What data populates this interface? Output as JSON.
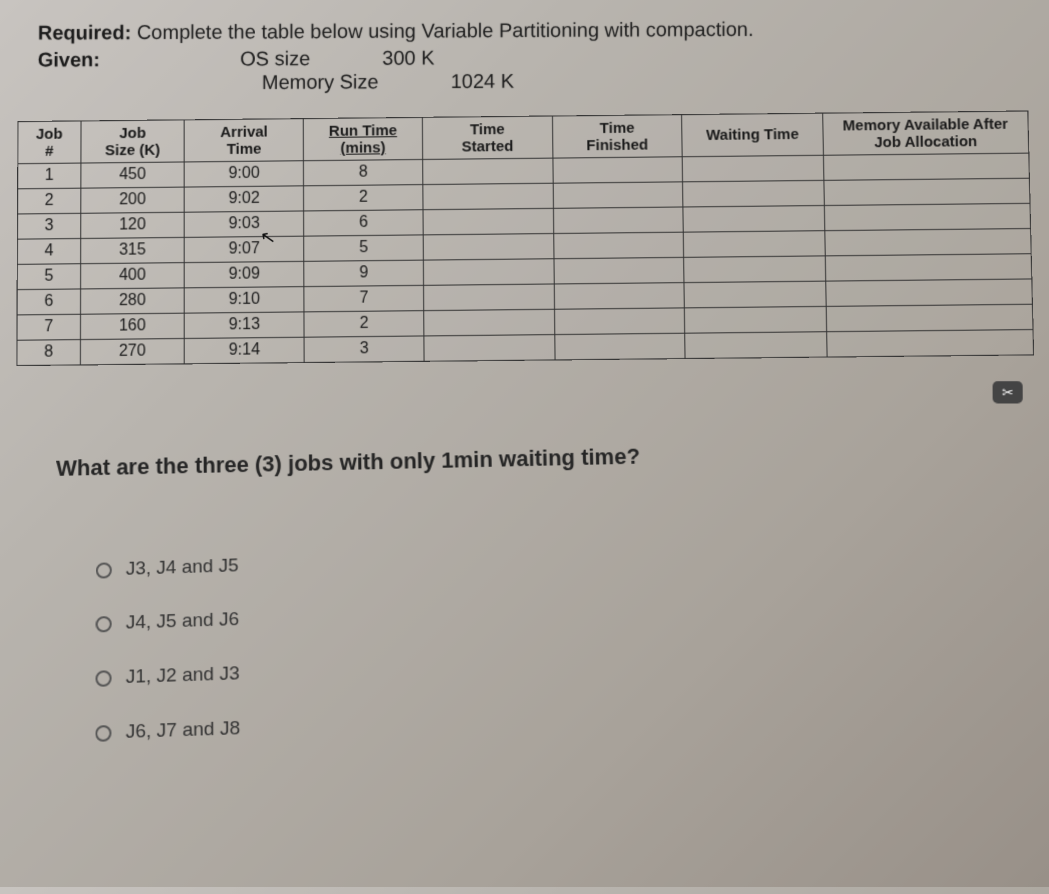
{
  "header": {
    "required_label": "Required:",
    "required_text": "Complete the table below using Variable Partitioning with compaction.",
    "given_label": "Given:",
    "os_label": "OS size",
    "os_value": "300 K",
    "mem_label": "Memory Size",
    "mem_value": "1024 K"
  },
  "table": {
    "headers": {
      "job": "Job\n#",
      "size": "Job\nSize (K)",
      "arrival": "Arrival\nTime",
      "runtime": "Run Time\n(mins)",
      "tstart": "Time\nStarted",
      "tfin": "Time\nFinished",
      "wait": "Waiting Time",
      "mem": "Memory Available After\nJob Allocation"
    },
    "rows": [
      {
        "job": "1",
        "size": "450",
        "arrival": "9:00",
        "runtime": "8",
        "tstart": "",
        "tfin": "",
        "wait": "",
        "mem": ""
      },
      {
        "job": "2",
        "size": "200",
        "arrival": "9:02",
        "runtime": "2",
        "tstart": "",
        "tfin": "",
        "wait": "",
        "mem": ""
      },
      {
        "job": "3",
        "size": "120",
        "arrival": "9:03",
        "runtime": "6",
        "tstart": "",
        "tfin": "",
        "wait": "",
        "mem": ""
      },
      {
        "job": "4",
        "size": "315",
        "arrival": "9:07",
        "runtime": "5",
        "tstart": "",
        "tfin": "",
        "wait": "",
        "mem": ""
      },
      {
        "job": "5",
        "size": "400",
        "arrival": "9:09",
        "runtime": "9",
        "tstart": "",
        "tfin": "",
        "wait": "",
        "mem": ""
      },
      {
        "job": "6",
        "size": "280",
        "arrival": "9:10",
        "runtime": "7",
        "tstart": "",
        "tfin": "",
        "wait": "",
        "mem": ""
      },
      {
        "job": "7",
        "size": "160",
        "arrival": "9:13",
        "runtime": "2",
        "tstart": "",
        "tfin": "",
        "wait": "",
        "mem": ""
      },
      {
        "job": "8",
        "size": "270",
        "arrival": "9:14",
        "runtime": "3",
        "tstart": "",
        "tfin": "",
        "wait": "",
        "mem": ""
      }
    ]
  },
  "question": "What are the three (3) jobs with only 1min waiting time?",
  "options": [
    "J3, J4 and J5",
    "J4, J5 and J6",
    "J1, J2 and J3",
    "J6, J7 and J8"
  ],
  "snip_badge": "✂"
}
